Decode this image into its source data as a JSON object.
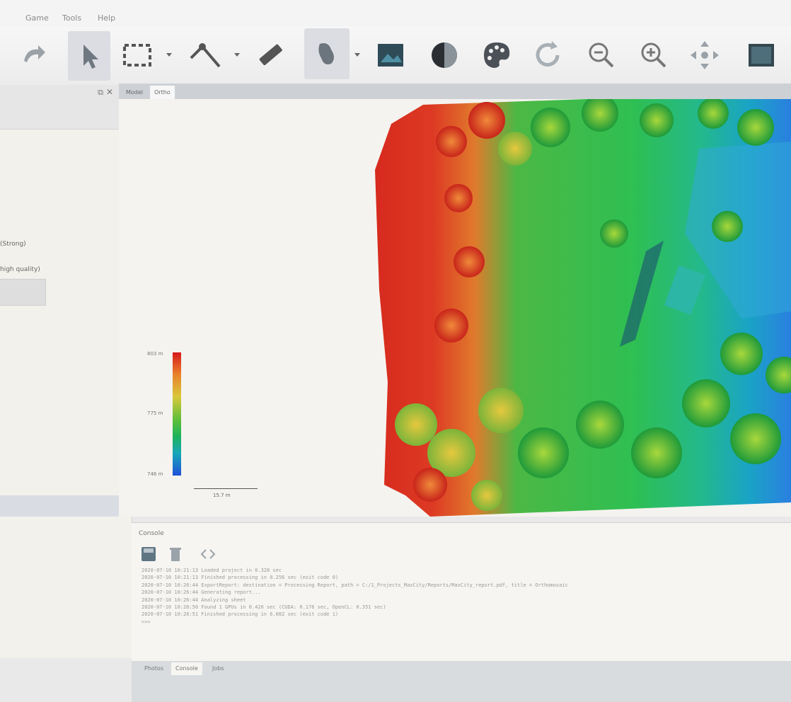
{
  "menubar": {
    "items": [
      "Game",
      "Tools",
      "Help"
    ]
  },
  "toolbar": {
    "tools": [
      "redo-icon",
      "pointer-icon",
      "rectangle-select-icon",
      "polyline-icon",
      "ruler-icon",
      "lasso-icon",
      "image-icon",
      "contrast-icon",
      "palette-icon",
      "refresh-icon",
      "zoom-out-icon",
      "zoom-in-icon",
      "pan-icon",
      "layer-icon"
    ]
  },
  "left_panel": {
    "options": [
      "(Strong)",
      "high quality)"
    ]
  },
  "view": {
    "tabs": [
      "Model",
      "Ortho"
    ]
  },
  "legend": {
    "max": "803 m",
    "mid": "775 m",
    "min": "746 m",
    "scale": "15.7 m"
  },
  "console": {
    "title": "Console",
    "lines": [
      "2020-07-10 10:21:13 Loaded project in 0.328 sec",
      "2020-07-10 10:21:13 Finished processing in 0.256 sec (exit code 0)",
      "2020-07-10 10:26:44 ExportReport: destination = Processing Report, path = C:/1_Projects_MaxCity/Reports/MaxCity_report.pdf, title = Orthomosaic",
      "2020-07-10 10:26:44 Generating report...",
      "2020-07-10 10:26:44 Analyzing sheet",
      "2020-07-10 10:26:50 Found 1 GPUs in 0.426 sec (CUDA: 0.176 sec, OpenCL: 0.351 sec)",
      "2020-07-10 10:26:51 Finished processing in 6.082 sec (exit code 1)",
      ">>>"
    ]
  },
  "bottom_tabs": [
    "Photos",
    "Console",
    "Jobs"
  ],
  "colors": {
    "accent": "#d7191c",
    "panel": "#f3f1ec",
    "toolbar": "#ececec"
  }
}
